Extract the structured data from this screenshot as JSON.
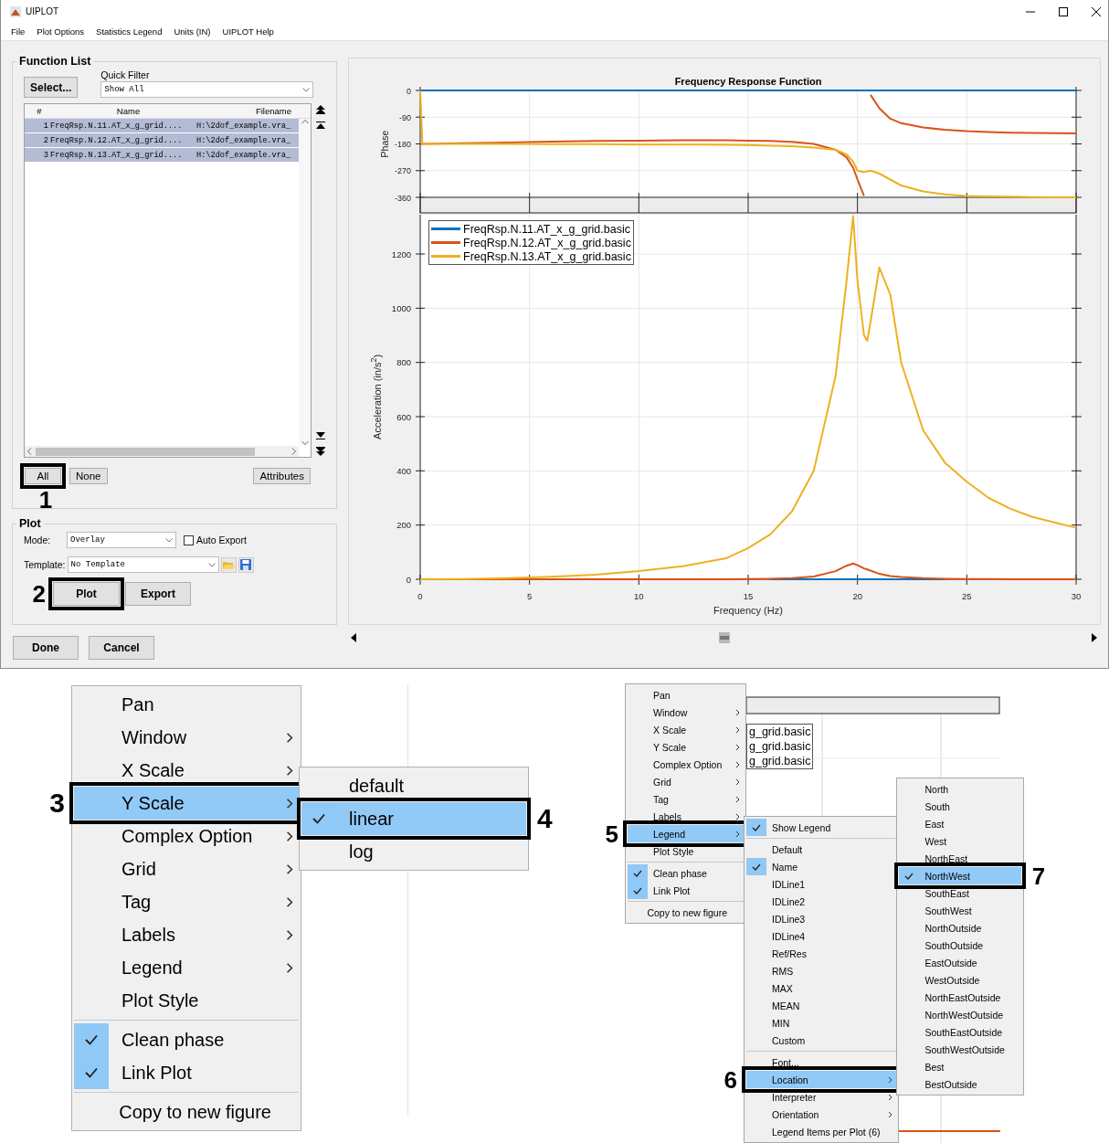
{
  "window": {
    "title": "UIPLOT"
  },
  "menubar": [
    "File",
    "Plot Options",
    "Statistics Legend",
    "Units (IN)",
    "UIPLOT Help"
  ],
  "function_list": {
    "title": "Function List",
    "select_button": "Select...",
    "quick_filter_label": "Quick Filter",
    "quick_filter_value": "Show All",
    "columns": [
      "#",
      "Name",
      "Filename"
    ],
    "rows": [
      {
        "index": "1",
        "name": "FreqRsp.N.11.AT_x_g_grid....",
        "filename": "H:\\2dof_example.vra_",
        "selected": true
      },
      {
        "index": "2",
        "name": "FreqRsp.N.12.AT_x_g_grid....",
        "filename": "H:\\2dof_example.vra_",
        "selected": true
      },
      {
        "index": "3",
        "name": "FreqRsp.N.13.AT_x_g_grid....",
        "filename": "H:\\2dof_example.vra_",
        "selected": true
      }
    ],
    "buttons": [
      {
        "label": "All",
        "callout": "1"
      },
      {
        "label": "None"
      },
      {
        "label": "Attributes"
      }
    ]
  },
  "plot": {
    "title": "Plot",
    "mode_label": "Mode:",
    "mode_value": "Overlay",
    "auto_export": {
      "label": "Auto Export",
      "checked": false
    },
    "template_label": "Template:",
    "template_value": "No Template",
    "buttons": [
      {
        "label": "Plot",
        "callout": "2"
      },
      {
        "label": "Export"
      }
    ]
  },
  "footer_buttons": [
    "Done",
    "Cancel"
  ],
  "phase_chart": {
    "chart_data": {
      "type": "line",
      "title": "Frequency Response Function",
      "ylabel": "Phase",
      "x": [
        0,
        0.1,
        2,
        4,
        6,
        8,
        10,
        12,
        14,
        15,
        16,
        17,
        18,
        19,
        19.5,
        19.8,
        20,
        20.3,
        20.45,
        20.6,
        21,
        21.5,
        22,
        23,
        24,
        25,
        26,
        27,
        28,
        29,
        30
      ],
      "xlim": [
        0,
        30
      ],
      "ylim": [
        -360,
        0
      ],
      "yticks": [
        0,
        -90,
        -180,
        -270,
        -360
      ],
      "grid": true,
      "series": [
        {
          "color": "#0072bd",
          "values": [
            0,
            0,
            0,
            0,
            0,
            0,
            0,
            0,
            0,
            0,
            0,
            0,
            0,
            0,
            0,
            0,
            0,
            0,
            0,
            0,
            0,
            0,
            0,
            0,
            0,
            0,
            0,
            0,
            0,
            0,
            0
          ]
        },
        {
          "color": "#d95319",
          "values": [
            -180,
            -180,
            -178,
            -175,
            -172,
            -170,
            -169,
            -168,
            -168,
            -169,
            -170,
            -173,
            -180,
            -200,
            -225,
            -260,
            -300,
            -355,
            null,
            -15,
            -60,
            -95,
            -110,
            -125,
            -132,
            -137,
            -140,
            -142,
            -143,
            -144,
            -145
          ]
        },
        {
          "color": "#edb120",
          "values": [
            0,
            -180,
            -180,
            -180,
            -181,
            -181,
            -182,
            -182,
            -183,
            -184,
            -186,
            -188,
            -192,
            -200,
            -215,
            -240,
            -270,
            -275,
            -272,
            -270,
            -280,
            -300,
            -320,
            -340,
            -350,
            -355,
            -357,
            -358,
            -359,
            -360,
            -360
          ]
        }
      ]
    }
  },
  "acceleration_chart": {
    "chart_data": {
      "type": "line",
      "xlabel": "Frequency (Hz)",
      "ylabel": "Acceleration (in/s$^{2}$)",
      "x": [
        0,
        0.1,
        2,
        4,
        6,
        8,
        10,
        12,
        14,
        15,
        16,
        17,
        18,
        19,
        19.5,
        19.8,
        20,
        20.3,
        20.45,
        20.6,
        21,
        21.5,
        22,
        23,
        24,
        25,
        26,
        27,
        28,
        29,
        30
      ],
      "xlim": [
        0,
        30
      ],
      "ylim": [
        0,
        1345
      ],
      "xticks": [
        0,
        5,
        10,
        15,
        20,
        25,
        30
      ],
      "yticks": [
        0,
        200,
        400,
        600,
        800,
        1000,
        1200
      ],
      "grid": true,
      "legend": true,
      "series": [
        {
          "name": "FreqRsp.N.11.AT_x_g_grid.basic",
          "color": "#0072bd",
          "values": [
            null,
            null,
            null,
            null,
            null,
            null,
            null,
            null,
            null,
            null,
            0,
            0,
            0,
            0,
            0,
            0,
            0,
            0,
            0,
            0,
            0,
            0,
            0,
            0,
            0,
            null,
            null,
            null,
            null,
            null,
            null
          ]
        },
        {
          "name": "FreqRsp.N.12.AT_x_g_grid.basic",
          "color": "#d95319",
          "values": [
            0,
            0,
            0,
            0,
            0,
            0,
            0,
            0,
            0,
            1,
            2,
            4,
            10,
            30,
            50,
            58,
            52,
            40,
            36,
            32,
            20,
            12,
            8,
            4,
            2,
            1,
            1,
            0,
            0,
            0,
            0
          ]
        },
        {
          "name": "FreqRsp.N.13.AT_x_g_grid.basic",
          "color": "#edb120",
          "values": [
            0,
            0,
            1,
            4,
            9,
            17,
            30,
            48,
            78,
            115,
            165,
            250,
            400,
            750,
            1100,
            1340,
            1100,
            900,
            880,
            950,
            1150,
            1050,
            800,
            550,
            430,
            360,
            300,
            260,
            230,
            210,
            190
          ]
        }
      ]
    }
  },
  "zoomed_menu": {
    "items": [
      {
        "kind": "item",
        "label": "Pan",
        "has_submenu": false,
        "checked": false,
        "selected": false
      },
      {
        "kind": "item",
        "label": "Window",
        "has_submenu": true,
        "checked": false,
        "selected": false
      },
      {
        "kind": "item",
        "label": "X Scale",
        "has_submenu": true,
        "checked": false,
        "selected": false
      },
      {
        "kind": "item",
        "label": "Y Scale",
        "has_submenu": true,
        "checked": false,
        "selected": true,
        "callout": "3",
        "submenu": {
          "items": [
            {
              "kind": "item",
              "label": "default",
              "has_submenu": false,
              "checked": false,
              "selected": false
            },
            {
              "kind": "item",
              "label": "linear",
              "has_submenu": false,
              "checked": true,
              "selected": true,
              "callout": "4"
            },
            {
              "kind": "item",
              "label": "log",
              "has_submenu": false,
              "checked": false,
              "selected": false
            }
          ]
        }
      },
      {
        "kind": "item",
        "label": "Complex Option",
        "has_submenu": true,
        "checked": false,
        "selected": false
      },
      {
        "kind": "item",
        "label": "Grid",
        "has_submenu": true,
        "checked": false,
        "selected": false
      },
      {
        "kind": "item",
        "label": "Tag",
        "has_submenu": true,
        "checked": false,
        "selected": false
      },
      {
        "kind": "item",
        "label": "Labels",
        "has_submenu": true,
        "checked": false,
        "selected": false
      },
      {
        "kind": "item",
        "label": "Legend",
        "has_submenu": true,
        "checked": false,
        "selected": false
      },
      {
        "kind": "item",
        "label": "Plot Style",
        "has_submenu": false,
        "checked": false,
        "selected": false
      },
      {
        "kind": "separator"
      },
      {
        "kind": "item",
        "label": "Clean phase",
        "has_submenu": false,
        "checked": true,
        "selected": false
      },
      {
        "kind": "item",
        "label": "Link Plot",
        "has_submenu": false,
        "checked": true,
        "selected": false
      },
      {
        "kind": "separator"
      },
      {
        "kind": "item",
        "label": "Copy to new figure",
        "has_submenu": false,
        "checked": false,
        "selected": false
      }
    ]
  },
  "context_menu": {
    "legend_fragment": [
      "g_grid.basic",
      "g_grid.basic",
      "g_grid.basic"
    ],
    "items": [
      {
        "kind": "item",
        "label": "Pan",
        "has_submenu": false,
        "checked": false,
        "selected": false
      },
      {
        "kind": "item",
        "label": "Window",
        "has_submenu": true,
        "checked": false,
        "selected": false
      },
      {
        "kind": "item",
        "label": "X Scale",
        "has_submenu": true,
        "checked": false,
        "selected": false
      },
      {
        "kind": "item",
        "label": "Y Scale",
        "has_submenu": true,
        "checked": false,
        "selected": false
      },
      {
        "kind": "item",
        "label": "Complex Option",
        "has_submenu": true,
        "checked": false,
        "selected": false
      },
      {
        "kind": "item",
        "label": "Grid",
        "has_submenu": true,
        "checked": false,
        "selected": false
      },
      {
        "kind": "item",
        "label": "Tag",
        "has_submenu": true,
        "checked": false,
        "selected": false
      },
      {
        "kind": "item",
        "label": "Labels",
        "has_submenu": true,
        "checked": false,
        "selected": false
      },
      {
        "kind": "item",
        "label": "Legend",
        "has_submenu": true,
        "checked": false,
        "selected": true,
        "callout": "5",
        "submenu": {
          "items": [
            {
              "kind": "item",
              "label": "Show Legend",
              "has_submenu": false,
              "checked": true,
              "selected": false
            },
            {
              "kind": "separator"
            },
            {
              "kind": "item",
              "label": "Default",
              "has_submenu": false,
              "checked": false,
              "selected": false
            },
            {
              "kind": "item",
              "label": "Name",
              "has_submenu": false,
              "checked": true,
              "selected": false
            },
            {
              "kind": "item",
              "label": "IDLine1",
              "has_submenu": false,
              "checked": false,
              "selected": false
            },
            {
              "kind": "item",
              "label": "IDLine2",
              "has_submenu": false,
              "checked": false,
              "selected": false
            },
            {
              "kind": "item",
              "label": "IDLine3",
              "has_submenu": false,
              "checked": false,
              "selected": false
            },
            {
              "kind": "item",
              "label": "IDLine4",
              "has_submenu": false,
              "checked": false,
              "selected": false
            },
            {
              "kind": "item",
              "label": "Ref/Res",
              "has_submenu": false,
              "checked": false,
              "selected": false
            },
            {
              "kind": "item",
              "label": "RMS",
              "has_submenu": false,
              "checked": false,
              "selected": false
            },
            {
              "kind": "item",
              "label": "MAX",
              "has_submenu": false,
              "checked": false,
              "selected": false
            },
            {
              "kind": "item",
              "label": "MEAN",
              "has_submenu": false,
              "checked": false,
              "selected": false
            },
            {
              "kind": "item",
              "label": "MIN",
              "has_submenu": false,
              "checked": false,
              "selected": false
            },
            {
              "kind": "item",
              "label": "Custom",
              "has_submenu": false,
              "checked": false,
              "selected": false
            },
            {
              "kind": "separator"
            },
            {
              "kind": "item",
              "label": "Font...",
              "has_submenu": false,
              "checked": false,
              "selected": false
            },
            {
              "kind": "item",
              "label": "Location",
              "has_submenu": true,
              "checked": false,
              "selected": true,
              "callout": "6",
              "submenu": {
                "items": [
                  {
                    "kind": "item",
                    "label": "North",
                    "has_submenu": false,
                    "checked": false,
                    "selected": false
                  },
                  {
                    "kind": "item",
                    "label": "South",
                    "has_submenu": false,
                    "checked": false,
                    "selected": false
                  },
                  {
                    "kind": "item",
                    "label": "East",
                    "has_submenu": false,
                    "checked": false,
                    "selected": false
                  },
                  {
                    "kind": "item",
                    "label": "West",
                    "has_submenu": false,
                    "checked": false,
                    "selected": false
                  },
                  {
                    "kind": "item",
                    "label": "NorthEast",
                    "has_submenu": false,
                    "checked": false,
                    "selected": false
                  },
                  {
                    "kind": "item",
                    "label": "NorthWest",
                    "has_submenu": false,
                    "checked": true,
                    "selected": true,
                    "callout": "7"
                  },
                  {
                    "kind": "item",
                    "label": "SouthEast",
                    "has_submenu": false,
                    "checked": false,
                    "selected": false
                  },
                  {
                    "kind": "item",
                    "label": "SouthWest",
                    "has_submenu": false,
                    "checked": false,
                    "selected": false
                  },
                  {
                    "kind": "item",
                    "label": "NorthOutside",
                    "has_submenu": false,
                    "checked": false,
                    "selected": false
                  },
                  {
                    "kind": "item",
                    "label": "SouthOutside",
                    "has_submenu": false,
                    "checked": false,
                    "selected": false
                  },
                  {
                    "kind": "item",
                    "label": "EastOutside",
                    "has_submenu": false,
                    "checked": false,
                    "selected": false
                  },
                  {
                    "kind": "item",
                    "label": "WestOutside",
                    "has_submenu": false,
                    "checked": false,
                    "selected": false
                  },
                  {
                    "kind": "item",
                    "label": "NorthEastOutside",
                    "has_submenu": false,
                    "checked": false,
                    "selected": false
                  },
                  {
                    "kind": "item",
                    "label": "NorthWestOutside",
                    "has_submenu": false,
                    "checked": false,
                    "selected": false
                  },
                  {
                    "kind": "item",
                    "label": "SouthEastOutside",
                    "has_submenu": false,
                    "checked": false,
                    "selected": false
                  },
                  {
                    "kind": "item",
                    "label": "SouthWestOutside",
                    "has_submenu": false,
                    "checked": false,
                    "selected": false
                  },
                  {
                    "kind": "item",
                    "label": "Best",
                    "has_submenu": false,
                    "checked": false,
                    "selected": false
                  },
                  {
                    "kind": "item",
                    "label": "BestOutside",
                    "has_submenu": false,
                    "checked": false,
                    "selected": false
                  }
                ]
              }
            },
            {
              "kind": "item",
              "label": "Interpreter",
              "has_submenu": true,
              "checked": false,
              "selected": false
            },
            {
              "kind": "item",
              "label": "Orientation",
              "has_submenu": true,
              "checked": false,
              "selected": false
            },
            {
              "kind": "item",
              "label": "Legend Items per Plot (6)",
              "has_submenu": false,
              "checked": false,
              "selected": false
            }
          ]
        }
      },
      {
        "kind": "item",
        "label": "Plot Style",
        "has_submenu": false,
        "checked": false,
        "selected": false
      },
      {
        "kind": "separator"
      },
      {
        "kind": "item",
        "label": "Clean phase",
        "has_submenu": false,
        "checked": true,
        "selected": false
      },
      {
        "kind": "item",
        "label": "Link Plot",
        "has_submenu": false,
        "checked": true,
        "selected": false
      },
      {
        "kind": "separator"
      },
      {
        "kind": "item",
        "label": "Copy to new figure",
        "has_submenu": false,
        "checked": false,
        "selected": false
      }
    ]
  }
}
